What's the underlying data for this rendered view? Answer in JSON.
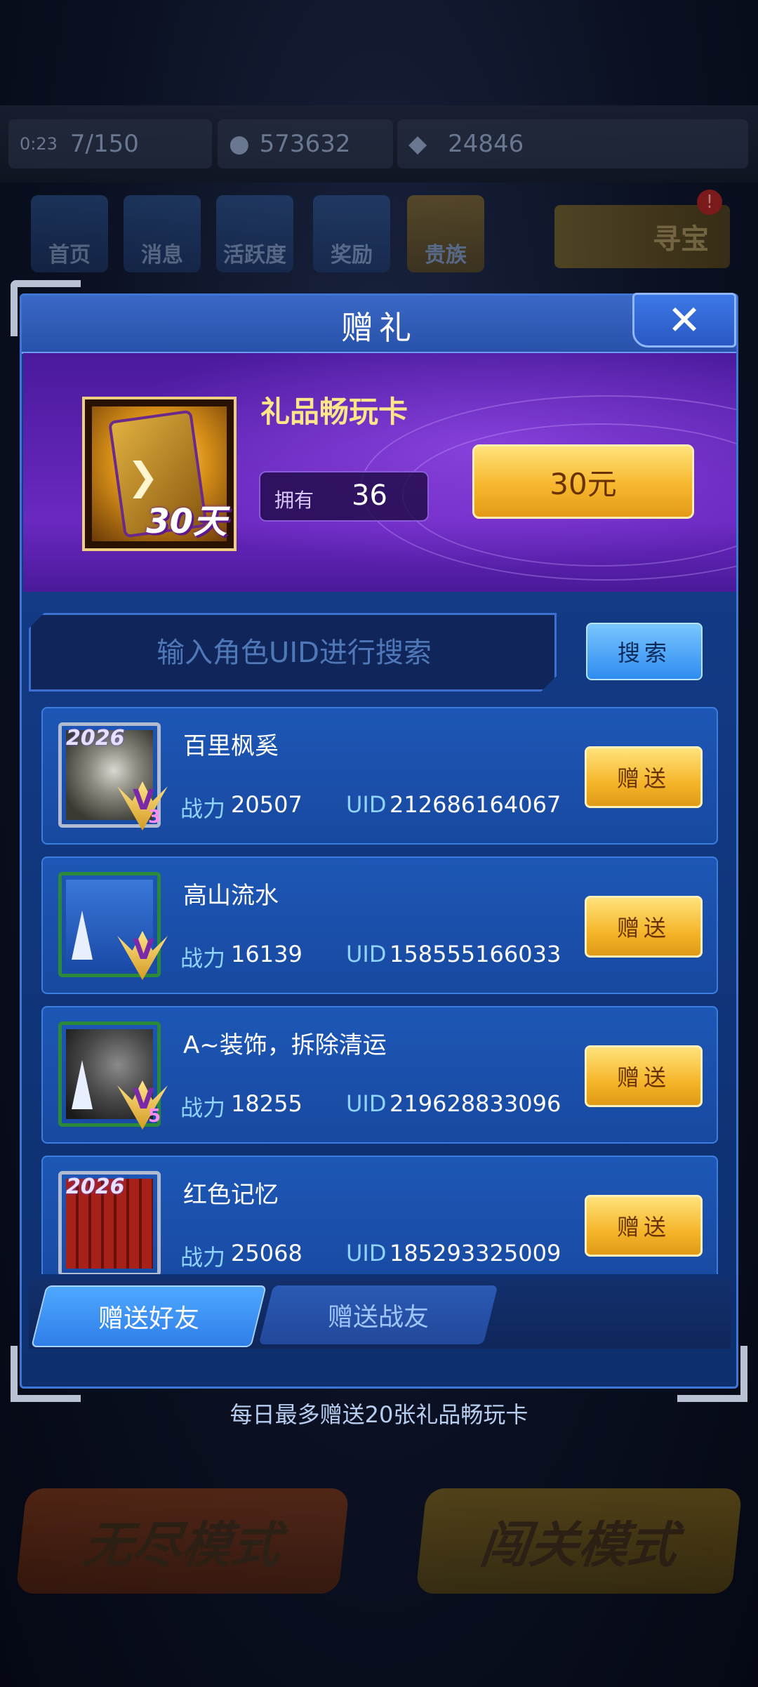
{
  "background": {
    "level_time": "0:23",
    "energy": "7/150",
    "coins": "573632",
    "gems": "24846",
    "nav": [
      "首页",
      "消息",
      "活跃度",
      "奖励",
      "贵族"
    ],
    "treasure": "寻宝",
    "treasure_badge": "!",
    "mode_left": "无尽模式",
    "mode_right": "闯关模式"
  },
  "dialog": {
    "title": "赠礼",
    "product": {
      "name": "礼品畅玩卡",
      "card_days": "30天",
      "own_label": "拥有",
      "own_count": "36",
      "price_label": "30元"
    },
    "search": {
      "placeholder": "输入角色UID进行搜索",
      "button": "搜索"
    },
    "players": [
      {
        "name": "百里枫奚",
        "power_label": "战力",
        "power": "20507",
        "uid_label": "UID",
        "uid": "212686164067",
        "frame_year": "2026",
        "rank_level": "3",
        "gift_button": "赠送"
      },
      {
        "name": "高山流水",
        "power_label": "战力",
        "power": "16139",
        "uid_label": "UID",
        "uid": "158555166033",
        "frame_year": "",
        "rank_level": "",
        "gift_button": "赠送"
      },
      {
        "name": "A~装饰，拆除清运",
        "power_label": "战力",
        "power": "18255",
        "uid_label": "UID",
        "uid": "219628833096",
        "frame_year": "",
        "rank_level": "5",
        "gift_button": "赠送"
      },
      {
        "name": "红色记忆",
        "power_label": "战力",
        "power": "25068",
        "uid_label": "UID",
        "uid": "185293325009",
        "frame_year": "2026",
        "rank_level": "",
        "gift_button": "赠送"
      }
    ],
    "tabs": {
      "active": "赠送好友",
      "inactive": "赠送战友"
    }
  },
  "hint": "每日最多赠送20张礼品畅玩卡",
  "colors": {
    "accent_gold": "#f7b72e",
    "panel_blue": "#1849a0",
    "banner_purple": "#6a28c0"
  }
}
